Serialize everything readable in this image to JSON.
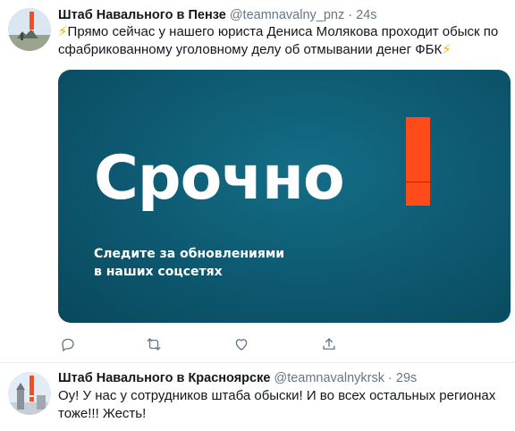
{
  "tweets": [
    {
      "author_name": "Штаб Навального в Пензе",
      "handle": "@teamnavalny_pnz",
      "separator": "·",
      "time": "24s",
      "bolt": "⚡",
      "text": "Прямо сейчас у нашего юриста Дениса Молякова проходит обыск по сфабрикованному уголовному делу об отмывании денег ФБК",
      "media": {
        "headline": "Срочно",
        "subline_1": "Следите за обновлениями",
        "subline_2": "в наших соцсетях",
        "background_color": "#0d5870",
        "accent_color": "#ff4a1a"
      },
      "actions": [
        "reply-icon",
        "retweet-icon",
        "like-icon",
        "share-icon"
      ]
    },
    {
      "author_name": "Штаб Навального в Красноярске",
      "handle": "@teamnavalnykrsk",
      "separator": "·",
      "time": "29s",
      "text": "Оу! У нас у сотрудников штаба обыски! И во всех остальных регионах тоже!!! Жесть!"
    }
  ],
  "colors": {
    "text_primary": "#14171a",
    "text_secondary": "#657786",
    "separator": "#e6ecf0",
    "bolt": "#f6b500"
  }
}
